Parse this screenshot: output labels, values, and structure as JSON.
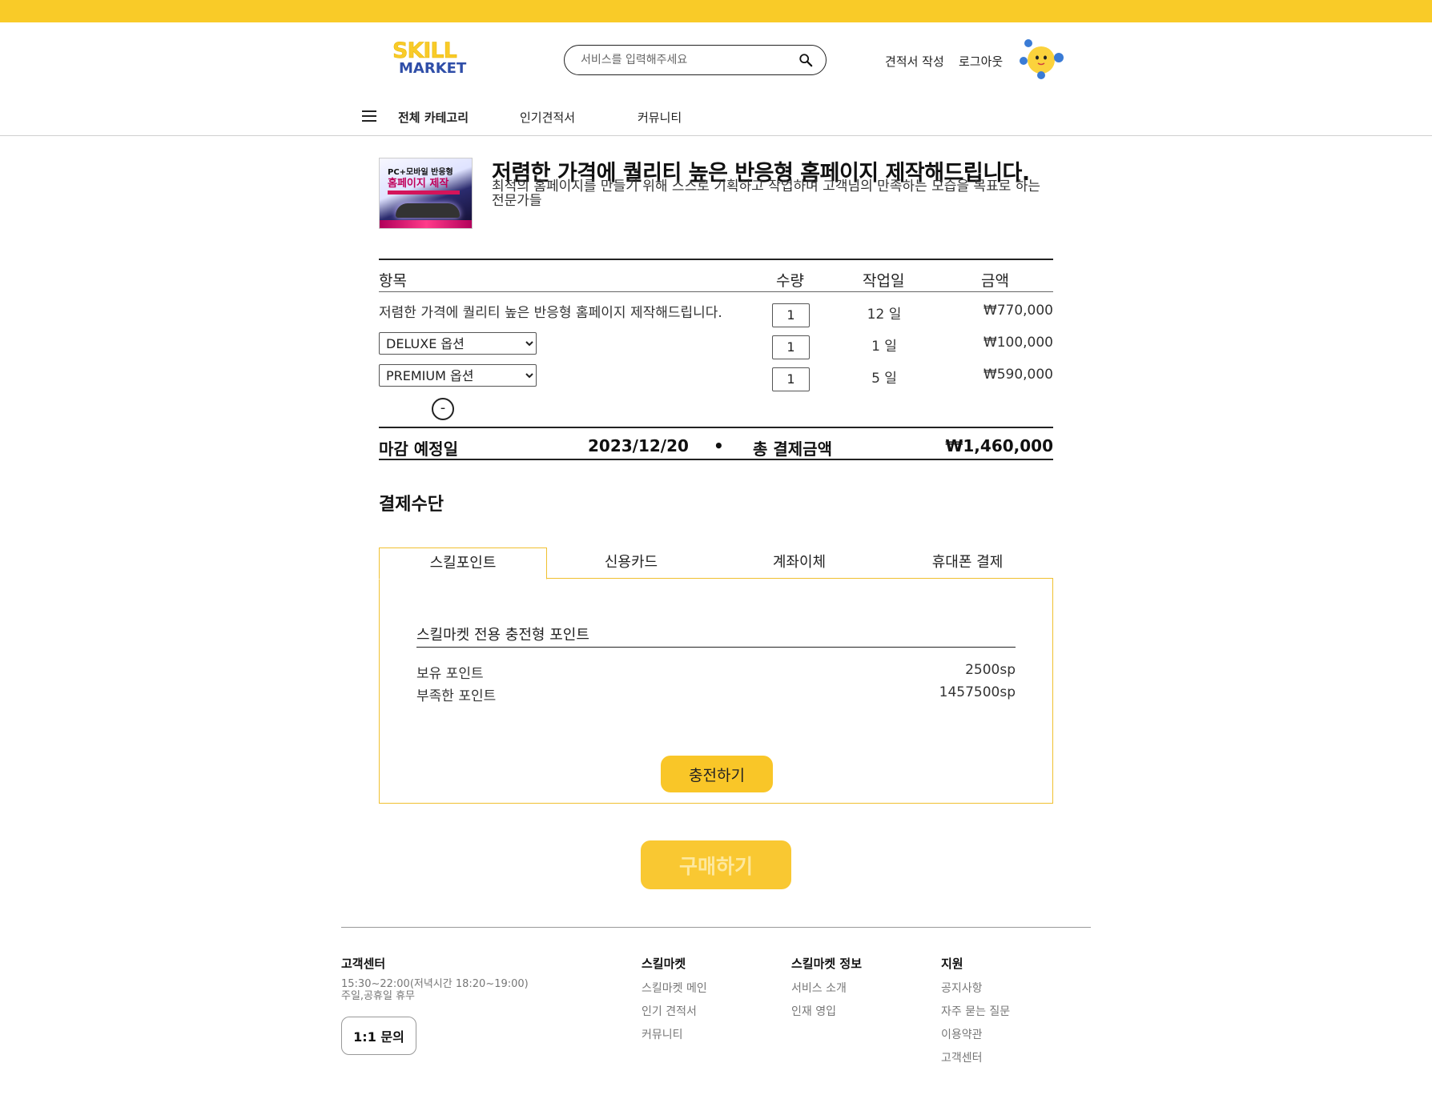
{
  "header": {
    "logo_top": "SKILL",
    "logo_bottom": "MARKET",
    "search_placeholder": "서비스를 입력해주세요",
    "write_quote": "견적서 작성",
    "logout": "로그아웃"
  },
  "nav": {
    "all_categories": "전체 카테고리",
    "popular_quotes": "인기견적서",
    "community": "커뮤니티"
  },
  "product": {
    "thumb_line1": "PC+모바일 반응형",
    "thumb_line2": "홈페이지 제작",
    "title": "저렴한 가격에 퀄리티 높은 반응형 홈페이지 제작해드립니다.",
    "description": "최적의 홈페이지를 만들기 위해 스스로 기획하고 작업하며 고객님의 만족하는 모습을 목표로 하는 전문가들"
  },
  "order": {
    "headers": {
      "item": "항목",
      "qty": "수량",
      "days": "작업일",
      "amount": "금액"
    },
    "rows": [
      {
        "name": "저렴한 가격에 퀄리티 높은 반응형 홈페이지 제작해드립니다.",
        "qty": "1",
        "days": "12 일",
        "price": "₩770,000"
      },
      {
        "option": "DELUXE 옵션",
        "qty": "1",
        "days": "1 일",
        "price": "₩100,000"
      },
      {
        "option": "PREMIUM 옵션",
        "qty": "1",
        "days": "5 일",
        "price": "₩590,000"
      }
    ],
    "remove_symbol": "-",
    "deadline_label": "마감 예정일",
    "deadline_value": "2023/12/20",
    "bullet": "•",
    "total_label": "총 결제금액",
    "total_value": "₩1,460,000"
  },
  "payment": {
    "title": "결제수단",
    "tabs": [
      "스킬포인트",
      "신용카드",
      "계좌이체",
      "휴대폰 결제"
    ],
    "active_tab": 0,
    "panel": {
      "title": "스킬마켓 전용 충전형 포인트",
      "owned_label": "보유 포인트",
      "owned_value": "2500sp",
      "short_label": "부족한 포인트",
      "short_value": "1457500sp",
      "charge_button": "충전하기"
    },
    "buy_button": "구매하기"
  },
  "footer": {
    "cs_title": "고객센터",
    "cs_hours": "15:30~22:00(저녁시간 18:20~19:00)",
    "cs_closed": "주일,공휴일 휴무",
    "inquiry_button": "1:1 문의",
    "col1_title": "스킬마켓",
    "col1_links": [
      "스킬마켓 메인",
      "인기 견적서",
      "커뮤니티"
    ],
    "col2_title": "스킬마켓 정보",
    "col2_links": [
      "서비스 소개",
      "인재 영입"
    ],
    "col3_title": "지원",
    "col3_links": [
      "공지사항",
      "자주 묻는 질문",
      "이용약관",
      "고객센터"
    ]
  },
  "colors": {
    "brand_yellow": "#f9cb28",
    "brand_blue": "#2f4ea8",
    "tab_border": "#f0c030"
  }
}
